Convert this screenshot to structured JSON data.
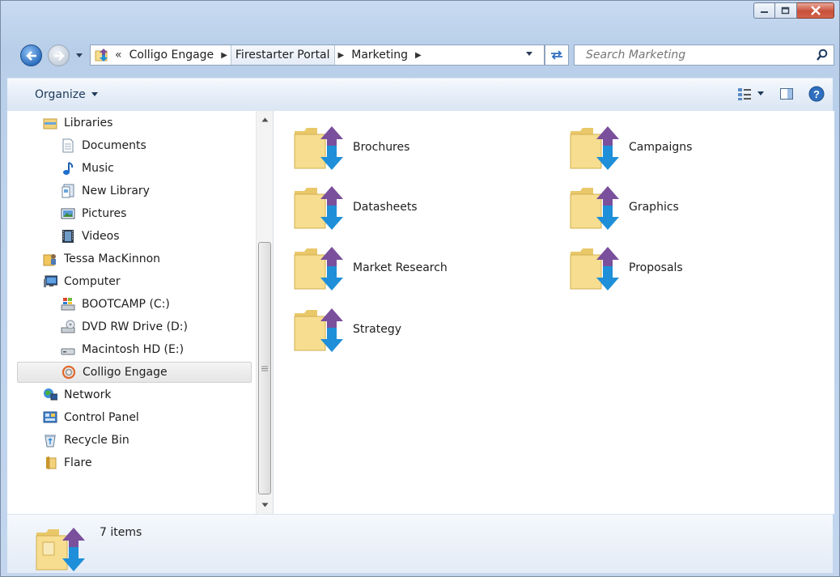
{
  "window": {
    "buttons": {
      "minimize": "minimize",
      "maximize": "maximize",
      "close": "close"
    }
  },
  "address": {
    "overflow": "«",
    "breadcrumbs": [
      "Colligo Engage",
      "Firestarter Portal",
      "Marketing"
    ]
  },
  "search": {
    "placeholder": "Search Marketing"
  },
  "toolbar": {
    "organize_label": "Organize"
  },
  "nav": {
    "items": [
      {
        "label": "Libraries",
        "icon": "libraries-icon"
      },
      {
        "label": "Documents",
        "icon": "documents-icon"
      },
      {
        "label": "Music",
        "icon": "music-icon"
      },
      {
        "label": "New Library",
        "icon": "library-icon"
      },
      {
        "label": "Pictures",
        "icon": "pictures-icon"
      },
      {
        "label": "Videos",
        "icon": "videos-icon"
      },
      {
        "label": "Tessa MacKinnon",
        "icon": "user-folder-icon"
      },
      {
        "label": "Computer",
        "icon": "computer-icon"
      },
      {
        "label": "BOOTCAMP (C:)",
        "icon": "windows-drive-icon"
      },
      {
        "label": "DVD RW Drive (D:)",
        "icon": "dvd-drive-icon"
      },
      {
        "label": "Macintosh HD (E:)",
        "icon": "hard-drive-icon"
      },
      {
        "label": "Colligo Engage",
        "icon": "colligo-icon"
      },
      {
        "label": "Network",
        "icon": "network-icon"
      },
      {
        "label": "Control Panel",
        "icon": "control-panel-icon"
      },
      {
        "label": "Recycle Bin",
        "icon": "recycle-bin-icon"
      },
      {
        "label": "Flare",
        "icon": "folder-icon"
      }
    ]
  },
  "folders": [
    "Brochures",
    "Campaigns",
    "Datasheets",
    "Graphics",
    "Market Research",
    "Proposals",
    "Strategy"
  ],
  "status": {
    "count_text": "7 items"
  },
  "colors": {
    "accent": "#1e395b",
    "sync_up": "#7a4f9c",
    "sync_down": "#1e8fd8",
    "folder": "#f6dd8f"
  }
}
